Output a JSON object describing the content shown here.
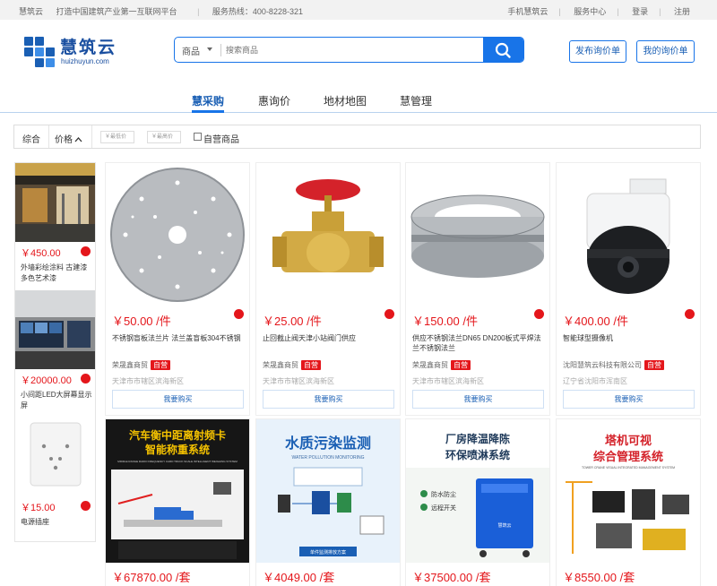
{
  "topbar": {
    "brand": "慧筑云",
    "slogan": "打造中国建筑产业第一互联网平台",
    "hotline": "服务热线：400-8228-321",
    "links": [
      "手机慧筑云",
      "服务中心",
      "登录",
      "注册"
    ]
  },
  "logo": {
    "name": "慧筑云",
    "url": "huizhuyun.com"
  },
  "search": {
    "category": "商品",
    "placeholder": "搜索商品",
    "button_icon": "search-icon"
  },
  "header_buttons": {
    "publish": "发布询价单",
    "mine": "我的询价单"
  },
  "nav": {
    "items": [
      "慧采购",
      "惠询价",
      "地材地图",
      "慧管理"
    ],
    "active": 0
  },
  "filter": {
    "sort_all": "综合",
    "sort_price": "价格",
    "min_price": "￥最低价",
    "max_price": "￥最高价",
    "self_operated": "自营商品"
  },
  "sidebar": {
    "items": [
      {
        "price": "￥450.00",
        "name": "外墙彩绘涂料 古建漆多色艺术漆"
      },
      {
        "price": "￥20000.00",
        "name": "小间距LED大屏幕显示屏"
      },
      {
        "price": "￥15.00",
        "name": "电源插座"
      }
    ]
  },
  "products": [
    {
      "price": "￥50.00 /件",
      "title": "不锈钢盲板法兰片 法兰盖盲板304不锈钢",
      "shop": "荣晟鑫商贸",
      "tag": "自营",
      "loc": "天津市市辖区滨海新区",
      "buy": "我要购买"
    },
    {
      "price": "￥25.00 /件",
      "title": "止回截止阀天津小站阀门供应",
      "shop": "荣晟鑫商贸",
      "tag": "自营",
      "loc": "天津市市辖区滨海新区",
      "buy": "我要购买"
    },
    {
      "price": "￥150.00 /件",
      "title": "供应不锈钢法兰DN65 DN200板式平焊法兰不锈钢法兰",
      "shop": "荣晟鑫商贸",
      "tag": "自营",
      "loc": "天津市市辖区滨海新区",
      "buy": "我要购买"
    },
    {
      "price": "￥400.00 /件",
      "title": "智能球型摄像机",
      "shop": "沈阳慧筑云科技有限公司",
      "tag": "自营",
      "loc": "辽宁省沈阳市浑南区",
      "buy": "我要购买"
    },
    {
      "price": "￥67870.00 /套",
      "banner": "汽车衡中距离射频卡智能称重系统",
      "banner_sub": "MIDDLE RANGE RADIO FREQUENCY CARD TRUCK SCALE INTELLIGENT WEIGHING SYSTEM"
    },
    {
      "price": "￥4049.00 /套",
      "banner": "水质污染监测",
      "banner_sub": "WATER POLLUTION MONITORING",
      "banner_footer": "单件监测排放方案"
    },
    {
      "price": "￥37500.00 /套",
      "banner": "厂房降温降陈环保喷淋系统",
      "bullets": [
        "防水防尘",
        "远程开关"
      ],
      "machine_text": "慧筑云"
    },
    {
      "price": "￥8550.00 /套",
      "banner": "塔机可视综合管理系统",
      "banner_sub": "TOWER CRANE VISUAL INTEGRATED MANAGEMENT SYSTEM"
    }
  ],
  "colors": {
    "brand_blue": "#1874e8",
    "price_red": "#e4161b",
    "nav_active": "#1a5fb4"
  }
}
